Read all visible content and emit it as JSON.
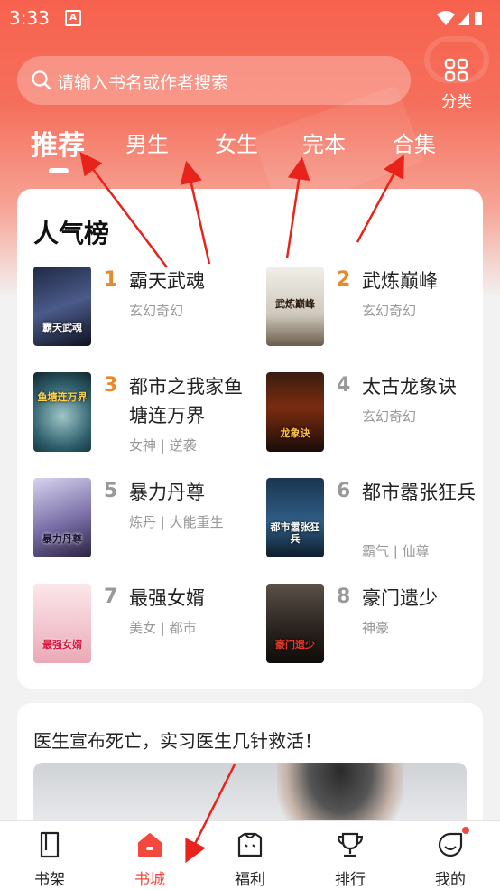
{
  "status": {
    "time": "3:33",
    "app_letter": "A"
  },
  "search": {
    "placeholder": "请输入书名或作者搜索"
  },
  "category": {
    "label": "分类"
  },
  "tabs": [
    {
      "label": "推荐",
      "active": true
    },
    {
      "label": "男生"
    },
    {
      "label": "女生"
    },
    {
      "label": "完本"
    },
    {
      "label": "合集"
    }
  ],
  "ranking": {
    "title": "人气榜",
    "books": [
      {
        "rank": "1",
        "title": "霸天武魂",
        "tags": "玄幻奇幻",
        "cover_text": "霸天武魂"
      },
      {
        "rank": "2",
        "title": "武炼巅峰",
        "tags": "玄幻奇幻",
        "cover_text": "武炼巅峰"
      },
      {
        "rank": "3",
        "title": "都市之我家鱼塘连万界",
        "tags": "女神 | 逆袭",
        "cover_text": "鱼塘连万界"
      },
      {
        "rank": "4",
        "title": "太古龙象诀",
        "tags": "玄幻奇幻",
        "cover_text": "龙象诀"
      },
      {
        "rank": "5",
        "title": "暴力丹尊",
        "tags": "炼丹 | 大能重生",
        "cover_text": "暴力丹尊"
      },
      {
        "rank": "6",
        "title": "都市嚣张狂兵",
        "tags": "霸气 | 仙尊",
        "cover_text": "都市嚣张狂兵"
      },
      {
        "rank": "7",
        "title": "最强女婿",
        "tags": "美女 | 都市",
        "cover_text": "最强女婿"
      },
      {
        "rank": "8",
        "title": "豪门遗少",
        "tags": "神豪",
        "cover_text": "豪门遗少"
      }
    ]
  },
  "feature": {
    "headline": "医生宣布死亡，实习医生几针救活！"
  },
  "nav": [
    {
      "label": "书架",
      "icon": "bookshelf-icon"
    },
    {
      "label": "书城",
      "icon": "store-icon",
      "active": true
    },
    {
      "label": "福利",
      "icon": "gift-shirt-icon"
    },
    {
      "label": "排行",
      "icon": "trophy-icon"
    },
    {
      "label": "我的",
      "icon": "profile-icon"
    }
  ],
  "colors": {
    "accent": "#f2483d",
    "rank_top": "#e8892b",
    "rank_other": "#999999",
    "header": "#f7624e"
  }
}
